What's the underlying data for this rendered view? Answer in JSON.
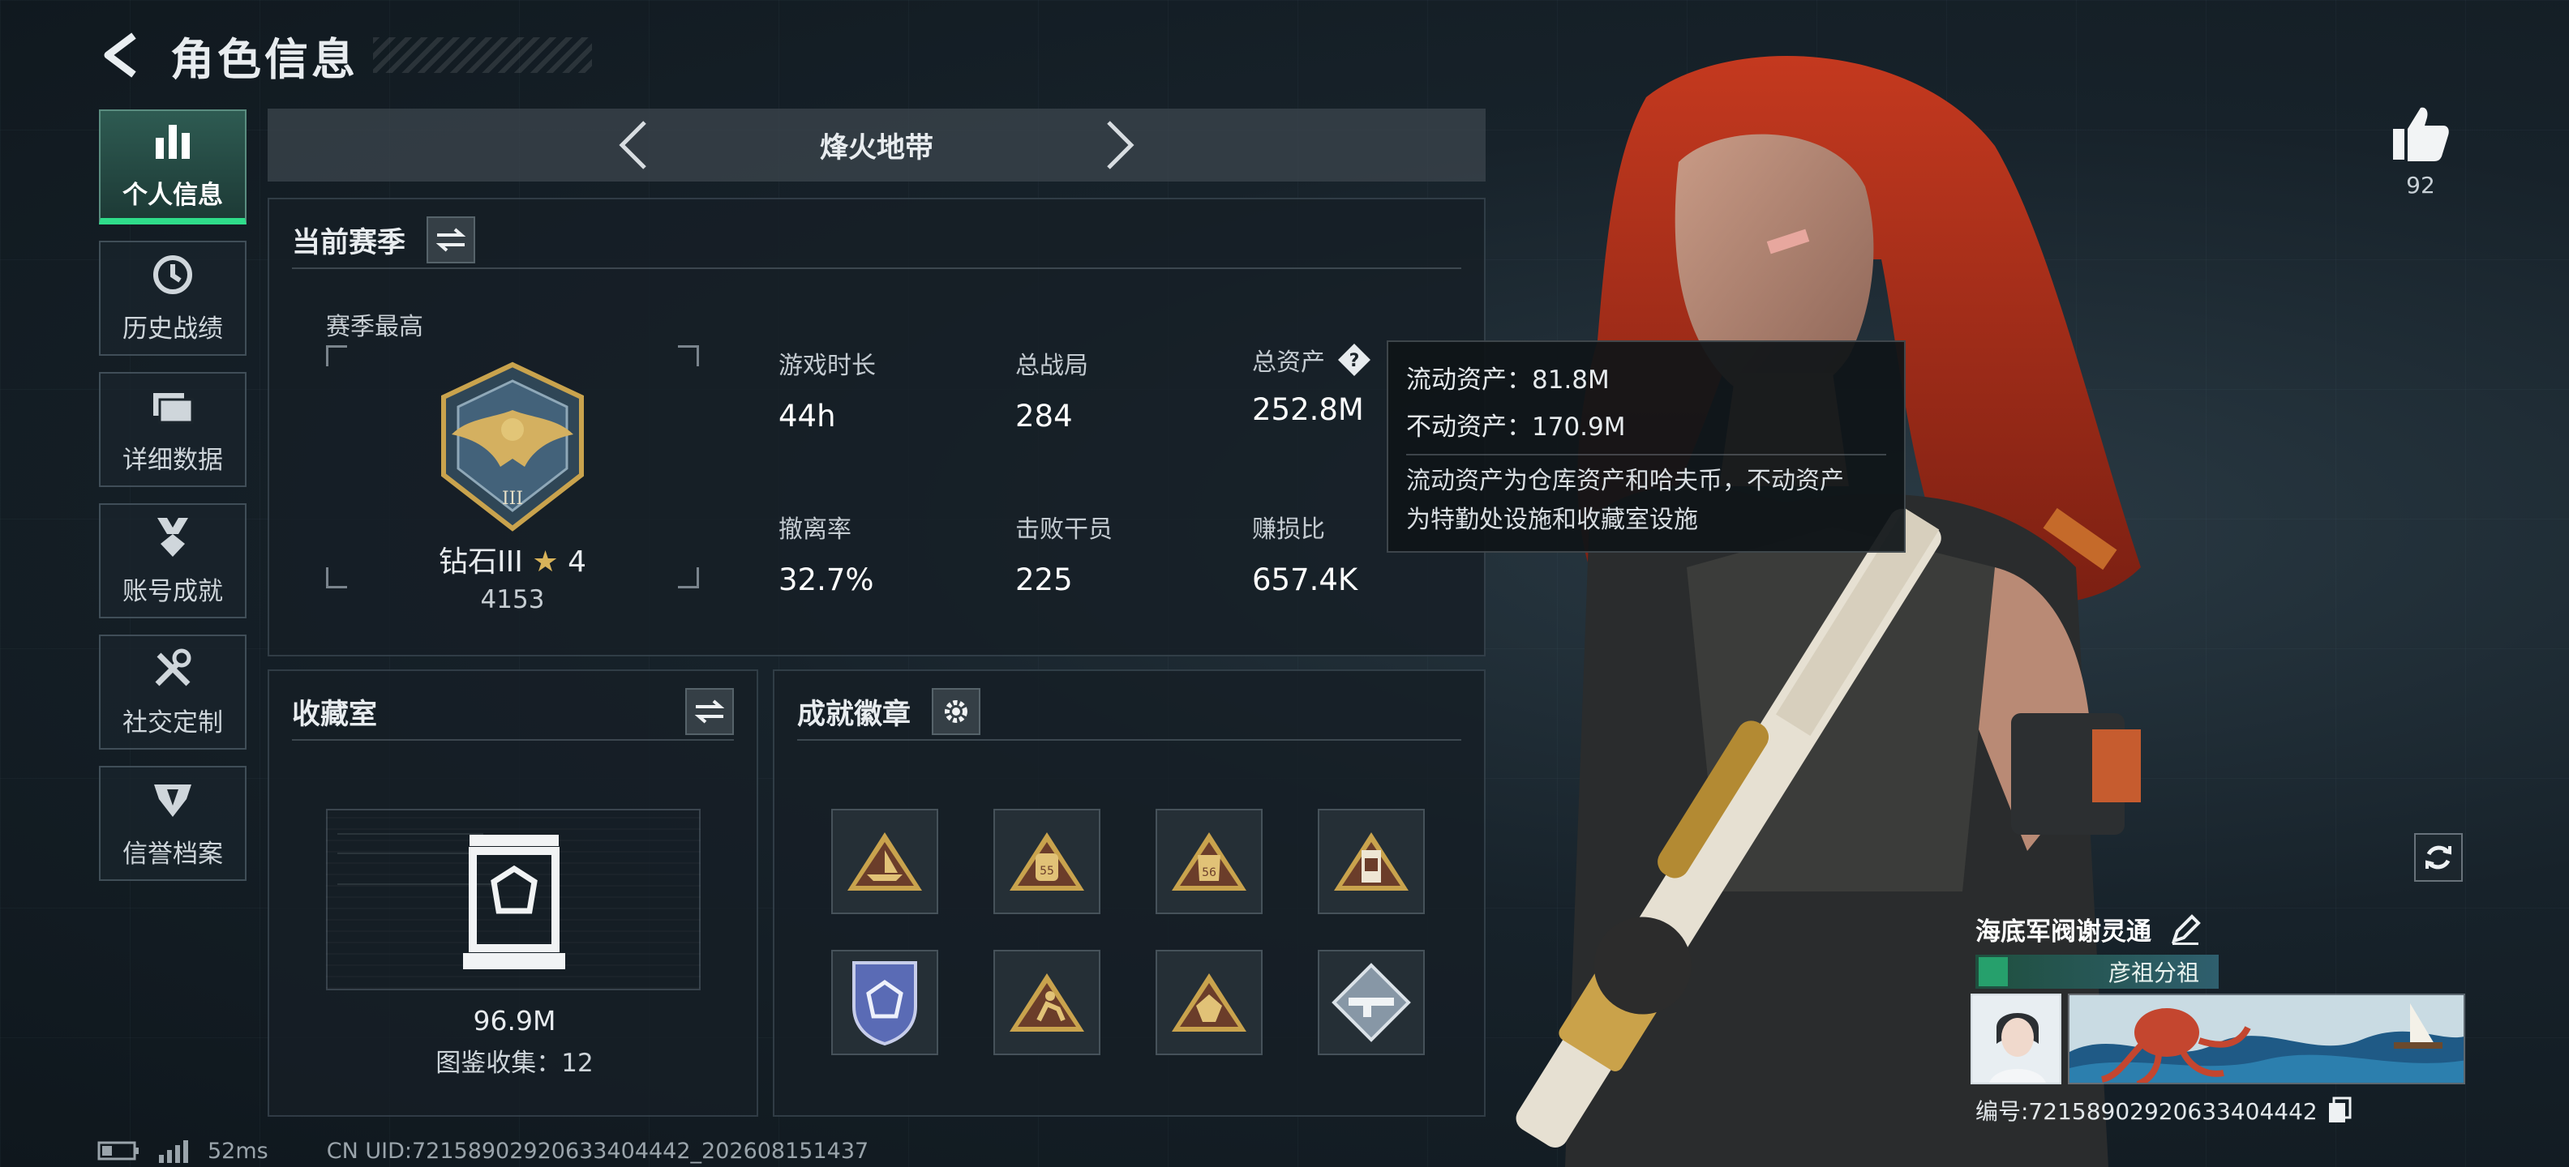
{
  "header": {
    "title": "角色信息"
  },
  "sidebar": {
    "items": [
      {
        "label": "个人信息",
        "icon": "bar-chart-icon",
        "active": true
      },
      {
        "label": "历史战绩",
        "icon": "clock-icon",
        "active": false
      },
      {
        "label": "详细数据",
        "icon": "folder-icon",
        "active": false
      },
      {
        "label": "账号成就",
        "icon": "medal-icon",
        "active": false
      },
      {
        "label": "社交定制",
        "icon": "tools-icon",
        "active": false
      },
      {
        "label": "信誉档案",
        "icon": "shield-icon",
        "active": false
      }
    ]
  },
  "mode": {
    "name": "烽火地带"
  },
  "season": {
    "title": "当前赛季",
    "best_label": "赛季最高",
    "rank_name": "钻石III",
    "rank_star_count": "4",
    "rank_points": "4153",
    "stats": [
      {
        "label": "游戏时长",
        "value": "44h"
      },
      {
        "label": "总战局",
        "value": "284"
      },
      {
        "label": "总资产",
        "value": "252.8M"
      },
      {
        "label": "撤离率",
        "value": "32.7%"
      },
      {
        "label": "击败干员",
        "value": "225"
      },
      {
        "label": "赚损比",
        "value": "657.4K"
      }
    ]
  },
  "tooltip": {
    "liquid": "流动资产：81.8M",
    "fixed": "不动资产：170.9M",
    "desc_line1": "流动资产为仓库资产和哈夫币，不动资产",
    "desc_line2": "为特勤处设施和收藏室设施"
  },
  "collection": {
    "title": "收藏室",
    "value": "96.9M",
    "count_text": "图鉴收集：12"
  },
  "badges": {
    "title": "成就徽章",
    "items": [
      {
        "icon": "ship-badge-icon",
        "text": ""
      },
      {
        "icon": "backpack-badge-icon",
        "text": "55"
      },
      {
        "icon": "armor-badge-icon",
        "text": "56"
      },
      {
        "icon": "canister-badge-icon",
        "text": ""
      },
      {
        "icon": "police-badge-icon",
        "text": ""
      },
      {
        "icon": "runner-badge-icon",
        "text": ""
      },
      {
        "icon": "gem-badge-icon",
        "text": ""
      },
      {
        "icon": "rifle-badge-icon",
        "text": ""
      }
    ]
  },
  "like": {
    "count": "92"
  },
  "player": {
    "name": "海底军阀谢灵通",
    "group": "彦祖分祖",
    "id_text": "编号:7215890292063340444​2"
  },
  "status": {
    "ping": "52ms",
    "uid": "CN UID:72158902920633404442_202608151437"
  },
  "colors": {
    "accent_green": "#2fdc8a",
    "gold": "#c9a34d",
    "hair_red": "#b8321f"
  }
}
